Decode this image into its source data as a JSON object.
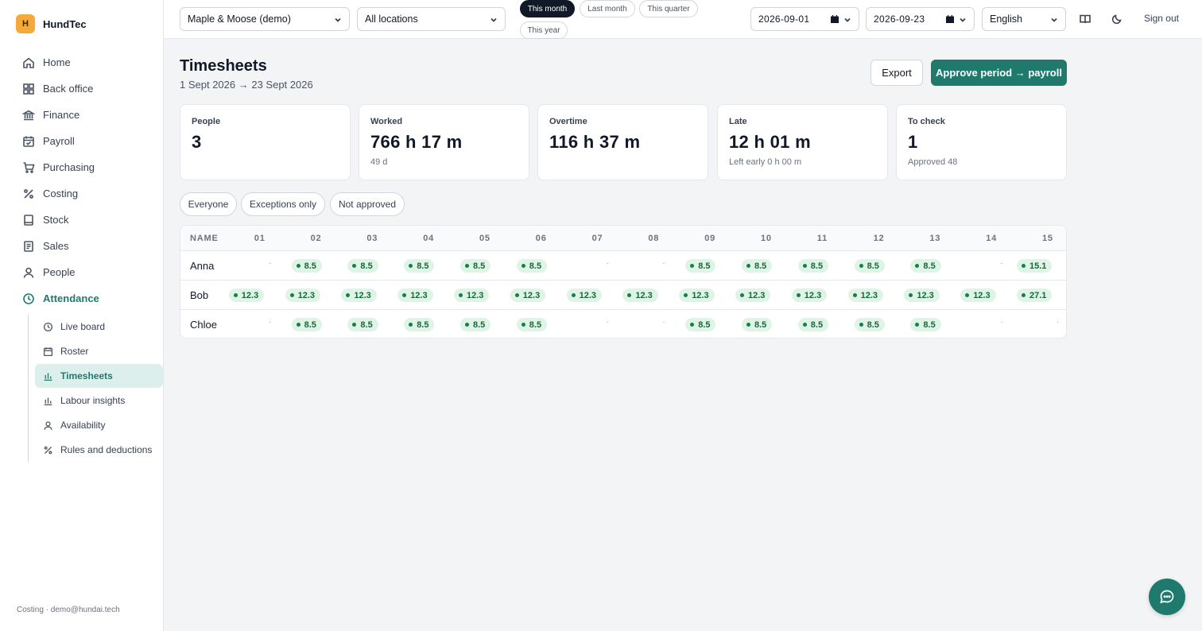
{
  "app": {
    "logo_letter": "H",
    "name": "HundTec"
  },
  "sidebar": {
    "items": [
      {
        "label": "Home",
        "icon": "home-icon"
      },
      {
        "label": "Back office",
        "icon": "grid-icon"
      },
      {
        "label": "Finance",
        "icon": "bank-icon"
      },
      {
        "label": "Payroll",
        "icon": "calendar-check-icon"
      },
      {
        "label": "Purchasing",
        "icon": "cart-icon"
      },
      {
        "label": "Costing",
        "icon": "percent-icon"
      },
      {
        "label": "Stock",
        "icon": "box-icon"
      },
      {
        "label": "Sales",
        "icon": "receipt-icon"
      },
      {
        "label": "People",
        "icon": "user-icon"
      },
      {
        "label": "Attendance",
        "icon": "clock-icon",
        "active": true
      }
    ],
    "subitems": [
      {
        "label": "Live board",
        "icon": "clock-icon"
      },
      {
        "label": "Roster",
        "icon": "calendar-icon"
      },
      {
        "label": "Timesheets",
        "icon": "bar-chart-icon",
        "active": true
      },
      {
        "label": "Labour insights",
        "icon": "bar-chart-icon"
      },
      {
        "label": "Availability",
        "icon": "user-icon"
      },
      {
        "label": "Rules and deductions",
        "icon": "percent-icon"
      }
    ],
    "footer": "Costing · demo@hundai.tech"
  },
  "topbar": {
    "company": "Maple & Moose (demo)",
    "location": "All locations",
    "periods": [
      "This month",
      "Last month",
      "This quarter",
      "This year"
    ],
    "active_period": "This month",
    "date_from": "2026-09-01",
    "date_to": "2026-09-23",
    "language": "English",
    "book_icon": "book-icon",
    "theme_icon": "moon-icon",
    "signout": "Sign out"
  },
  "page": {
    "title": "Timesheets",
    "subtitle": "1 Sept 2026 → 23 Sept 2026",
    "export_label": "Export",
    "approve_label": "Approve period → payroll"
  },
  "stats": [
    {
      "label": "People",
      "value": "3",
      "sub": ""
    },
    {
      "label": "Worked",
      "value": "766 h 17 m",
      "sub": "49 d"
    },
    {
      "label": "Overtime",
      "value": "116 h 37 m",
      "sub": ""
    },
    {
      "label": "Late",
      "value": "12 h 01 m",
      "sub": "Left early 0 h 00 m"
    },
    {
      "label": "To check",
      "value": "1",
      "sub": "Approved 48"
    }
  ],
  "filters": [
    "Everyone",
    "Exceptions only",
    "Not approved"
  ],
  "table": {
    "name_header": "NAME",
    "days": [
      "01",
      "02",
      "03",
      "04",
      "05",
      "06",
      "07",
      "08",
      "09",
      "10",
      "11",
      "12",
      "13",
      "14",
      "15"
    ],
    "rows": [
      {
        "name": "Anna",
        "hours": [
          "·",
          "8.5",
          "8.5",
          "8.5",
          "8.5",
          "8.5",
          "·",
          "·",
          "8.5",
          "8.5",
          "8.5",
          "8.5",
          "8.5",
          "·",
          "15.1"
        ]
      },
      {
        "name": "Bob",
        "hours": [
          "12.3",
          "12.3",
          "12.3",
          "12.3",
          "12.3",
          "12.3",
          "12.3",
          "12.3",
          "12.3",
          "12.3",
          "12.3",
          "12.3",
          "12.3",
          "12.3",
          "27.1"
        ]
      },
      {
        "name": "Chloe",
        "hours": [
          "·",
          "8.5",
          "8.5",
          "8.5",
          "8.5",
          "8.5",
          "·",
          "·",
          "8.5",
          "8.5",
          "8.5",
          "8.5",
          "8.5",
          "·",
          "·"
        ]
      }
    ]
  },
  "chat_icon": "chat-icon",
  "colors": {
    "accent": "#1f7a6d",
    "brand": "#f6a93b",
    "chip_bg": "#dff3e6",
    "chip_text": "#166a3a"
  }
}
